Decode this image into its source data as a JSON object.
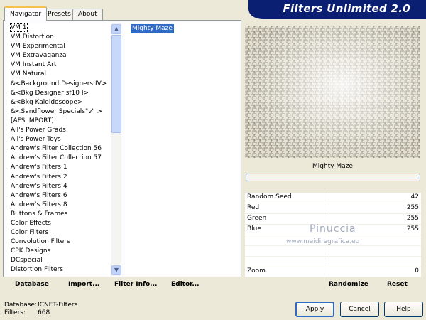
{
  "tabs": [
    {
      "label": "Navigator"
    },
    {
      "label": "Presets"
    },
    {
      "label": "About"
    }
  ],
  "banner": {
    "title": "Filters Unlimited 2.0"
  },
  "categories": [
    {
      "label": "VM 1"
    },
    {
      "label": "VM Distortion"
    },
    {
      "label": "VM Experimental"
    },
    {
      "label": "VM Extravaganza"
    },
    {
      "label": "VM Instant Art"
    },
    {
      "label": "VM Natural"
    },
    {
      "label": "&<Background Designers IV>"
    },
    {
      "label": "&<Bkg Designer sf10 I>"
    },
    {
      "label": "&<Bkg Kaleidoscope>"
    },
    {
      "label": "&<Sandflower Specials\"v\" >"
    },
    {
      "label": "[AFS IMPORT]"
    },
    {
      "label": "All's Power Grads"
    },
    {
      "label": "All's Power Toys"
    },
    {
      "label": "Andrew's Filter Collection 56"
    },
    {
      "label": "Andrew's Filter Collection 57"
    },
    {
      "label": "Andrew's Filters 1"
    },
    {
      "label": "Andrew's Filters 2"
    },
    {
      "label": "Andrew's Filters 4"
    },
    {
      "label": "Andrew's Filters 6"
    },
    {
      "label": "Andrew's Filters 8"
    },
    {
      "label": "Buttons & Frames"
    },
    {
      "label": "Color Effects"
    },
    {
      "label": "Color Filters"
    },
    {
      "label": "Convolution Filters"
    },
    {
      "label": "CPK Designs"
    },
    {
      "label": "DCspecial"
    },
    {
      "label": "Distortion Filters"
    }
  ],
  "selected_filter": "Mighty Maze",
  "left_buttons": {
    "database": "Database",
    "import": "Import...",
    "filter_info": "Filter Info...",
    "editor": "Editor..."
  },
  "preview_label": "Mighty Maze",
  "params": [
    {
      "name": "Random Seed",
      "value": "42"
    },
    {
      "name": "Red",
      "value": "255"
    },
    {
      "name": "Green",
      "value": "255"
    },
    {
      "name": "Blue",
      "value": "255"
    },
    {
      "name": "",
      "value": ""
    },
    {
      "name": "",
      "value": ""
    },
    {
      "name": "",
      "value": ""
    },
    {
      "name": "Zoom",
      "value": "0"
    }
  ],
  "watermark": {
    "name": "Pinuccia",
    "url": "www.maidiregrafica.eu"
  },
  "right_buttons": {
    "randomize": "Randomize",
    "reset": "Reset"
  },
  "status": {
    "database_label": "Database:",
    "database_value": "ICNET-Filters",
    "filters_label": "Filters:",
    "filters_value": "668"
  },
  "dialog_buttons": {
    "apply": "Apply",
    "cancel": "Cancel",
    "help": "Help"
  }
}
